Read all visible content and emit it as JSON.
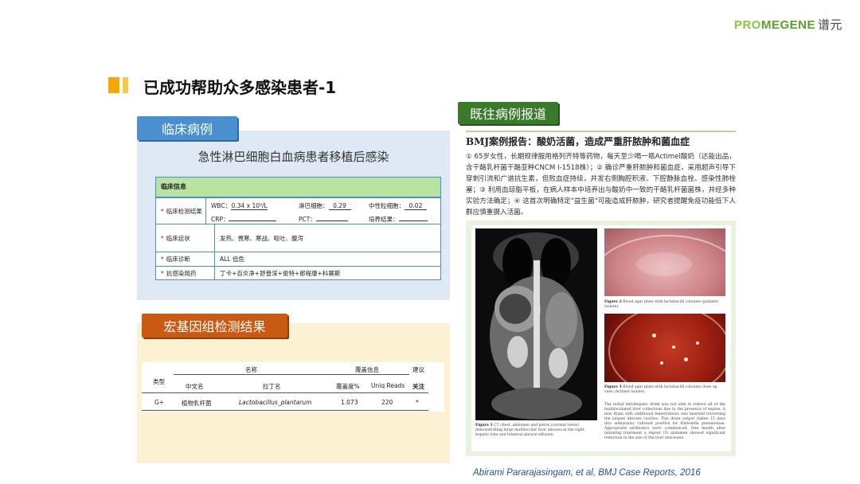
{
  "logo": {
    "part1": "PRO",
    "part2": "MEGENE",
    "part3": "谱元"
  },
  "title": "已成功帮助众多感染患者-1",
  "clinical": {
    "tab": "临床病例",
    "case_title": "急性淋巴细胞白血病患者移植后感染",
    "header": "临床信息",
    "rows": [
      {
        "key": "临床检测结果"
      },
      {
        "key": "临床症状",
        "value": "发热、畏寒、寒战、呕吐、腹泻"
      },
      {
        "key": "临床诊断",
        "value": "ALL 低危"
      },
      {
        "key": "抗感染用药",
        "value": "丁卡+百炎净+舒普深+俊特+郎程康+科赛斯"
      }
    ],
    "labs": [
      {
        "label": "WBC：",
        "value": "0.34 x 10⁹/L"
      },
      {
        "label": "淋巴细胞：",
        "value": "0.29"
      },
      {
        "label": "中性粒细胞：",
        "value": "0.02"
      },
      {
        "label": "CRP：",
        "value": ""
      },
      {
        "label": "PCT：",
        "value": ""
      },
      {
        "label": "培养结果：",
        "value": ""
      }
    ]
  },
  "meta": {
    "tab": "宏基因组检测结果",
    "headers": {
      "type": "类型",
      "name": "名称",
      "coverage": "覆盖信息",
      "suggest": "建议",
      "cn": "中文名",
      "latin": "拉丁名",
      "cov_pct": "覆盖度%",
      "reads": "Uniq Reads",
      "focus": "关注"
    },
    "row": {
      "type": "G+",
      "cn": "植物乳杆菌",
      "latin": "Lactobacillus_plantarum",
      "cov_pct": "1.073",
      "reads": "220",
      "focus": "*"
    }
  },
  "report": {
    "tab": "既往病例报道",
    "headline": "BMJ案例报告：酸奶活菌，造成严重肝脓肿和菌血症",
    "body": "① 65岁女性，长期规律服用格列齐特等药物，每天至少喝一瓶Actimel酸奶（达能出品，含干酪乳杆菌干酪亚种CNCM I-1518株）；② 确诊严重肝脓肿和菌血症，采用超声引导下穿刺引流和广谱抗生素，但败血症持续，并发右侧胸腔积液、下腔静脉血栓、感染性肺栓塞；③ 利用血琼脂平板，在病人样本中培养出与酸奶中一致的干酪乳杆菌菌株，并经多种实验方法确定；④ 这首次明确特定\"益生菌\"可能造成肝脓肿，研究者提醒免疫功能低下人群应慎重摄入活菌。",
    "fig1_label": "Figure 1",
    "fig1_caption": "CT chest, abdomen and pelvis (coronal views) demonstrating large multilocular liver abscess in the right hepatic lobe and bilateral pleural effusion.",
    "fig2_label": "Figure 2",
    "fig2_caption": "Blood agar plate with lactobacilli colonies (patients isolate).",
    "fig3_label": "Figure 3",
    "fig3_caption": "Blood agar plate with lactobacilli colonies close up view (Actimel isolate).",
    "fig_text": "The initial intrahepatic drain was not able to relieve all of the multiloculated liver collections due to the presence of septae. A new drain with additional fenestrations was inserted traversing the largest abscess cavities. This drain output (taken 15 days into admission) cultured positive for Klebsiella pneumoniae. Appropriate antibiotics were commenced. One month after initiating treatment a repeat US abdomen showed significant reduction in the size of the liver abscesses."
  },
  "citation": "Abirami Pararajasingam, et al, BMJ Case Reports, 2016",
  "colors": {
    "accent_yellow": "#f5a800",
    "tab_blue": "#4a8fd0",
    "tab_orange": "#c85a14",
    "tab_green": "#3a7a2a",
    "header_green": "#b9e3a2",
    "citation_blue": "#1f4e9c"
  }
}
